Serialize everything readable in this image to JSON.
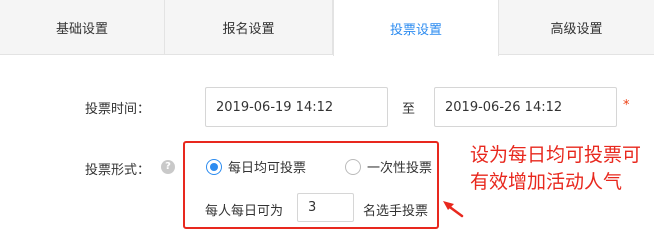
{
  "tabs": [
    {
      "label": "基础设置",
      "active": false
    },
    {
      "label": "报名设置",
      "active": false
    },
    {
      "label": "投票设置",
      "active": true
    },
    {
      "label": "高级设置",
      "active": false
    }
  ],
  "vote_time": {
    "label": "投票时间：",
    "start": "2019-06-19 14:12",
    "separator": "至",
    "end": "2019-06-26 14:12",
    "required_mark": "*"
  },
  "vote_form": {
    "label": "投票形式：",
    "help_icon": "question-icon",
    "options": [
      {
        "label": "每日均可投票",
        "checked": true
      },
      {
        "label": "一次性投票",
        "checked": false
      }
    ],
    "per_day_prefix": "每人每日可为",
    "per_day_value": "3",
    "per_day_suffix": "名选手投票"
  },
  "annotation": {
    "text": "设为每日均可投票可有效增加活动人气",
    "color": "#e8281e"
  },
  "colors": {
    "accent": "#2d8cf0",
    "required": "#ed4014"
  }
}
